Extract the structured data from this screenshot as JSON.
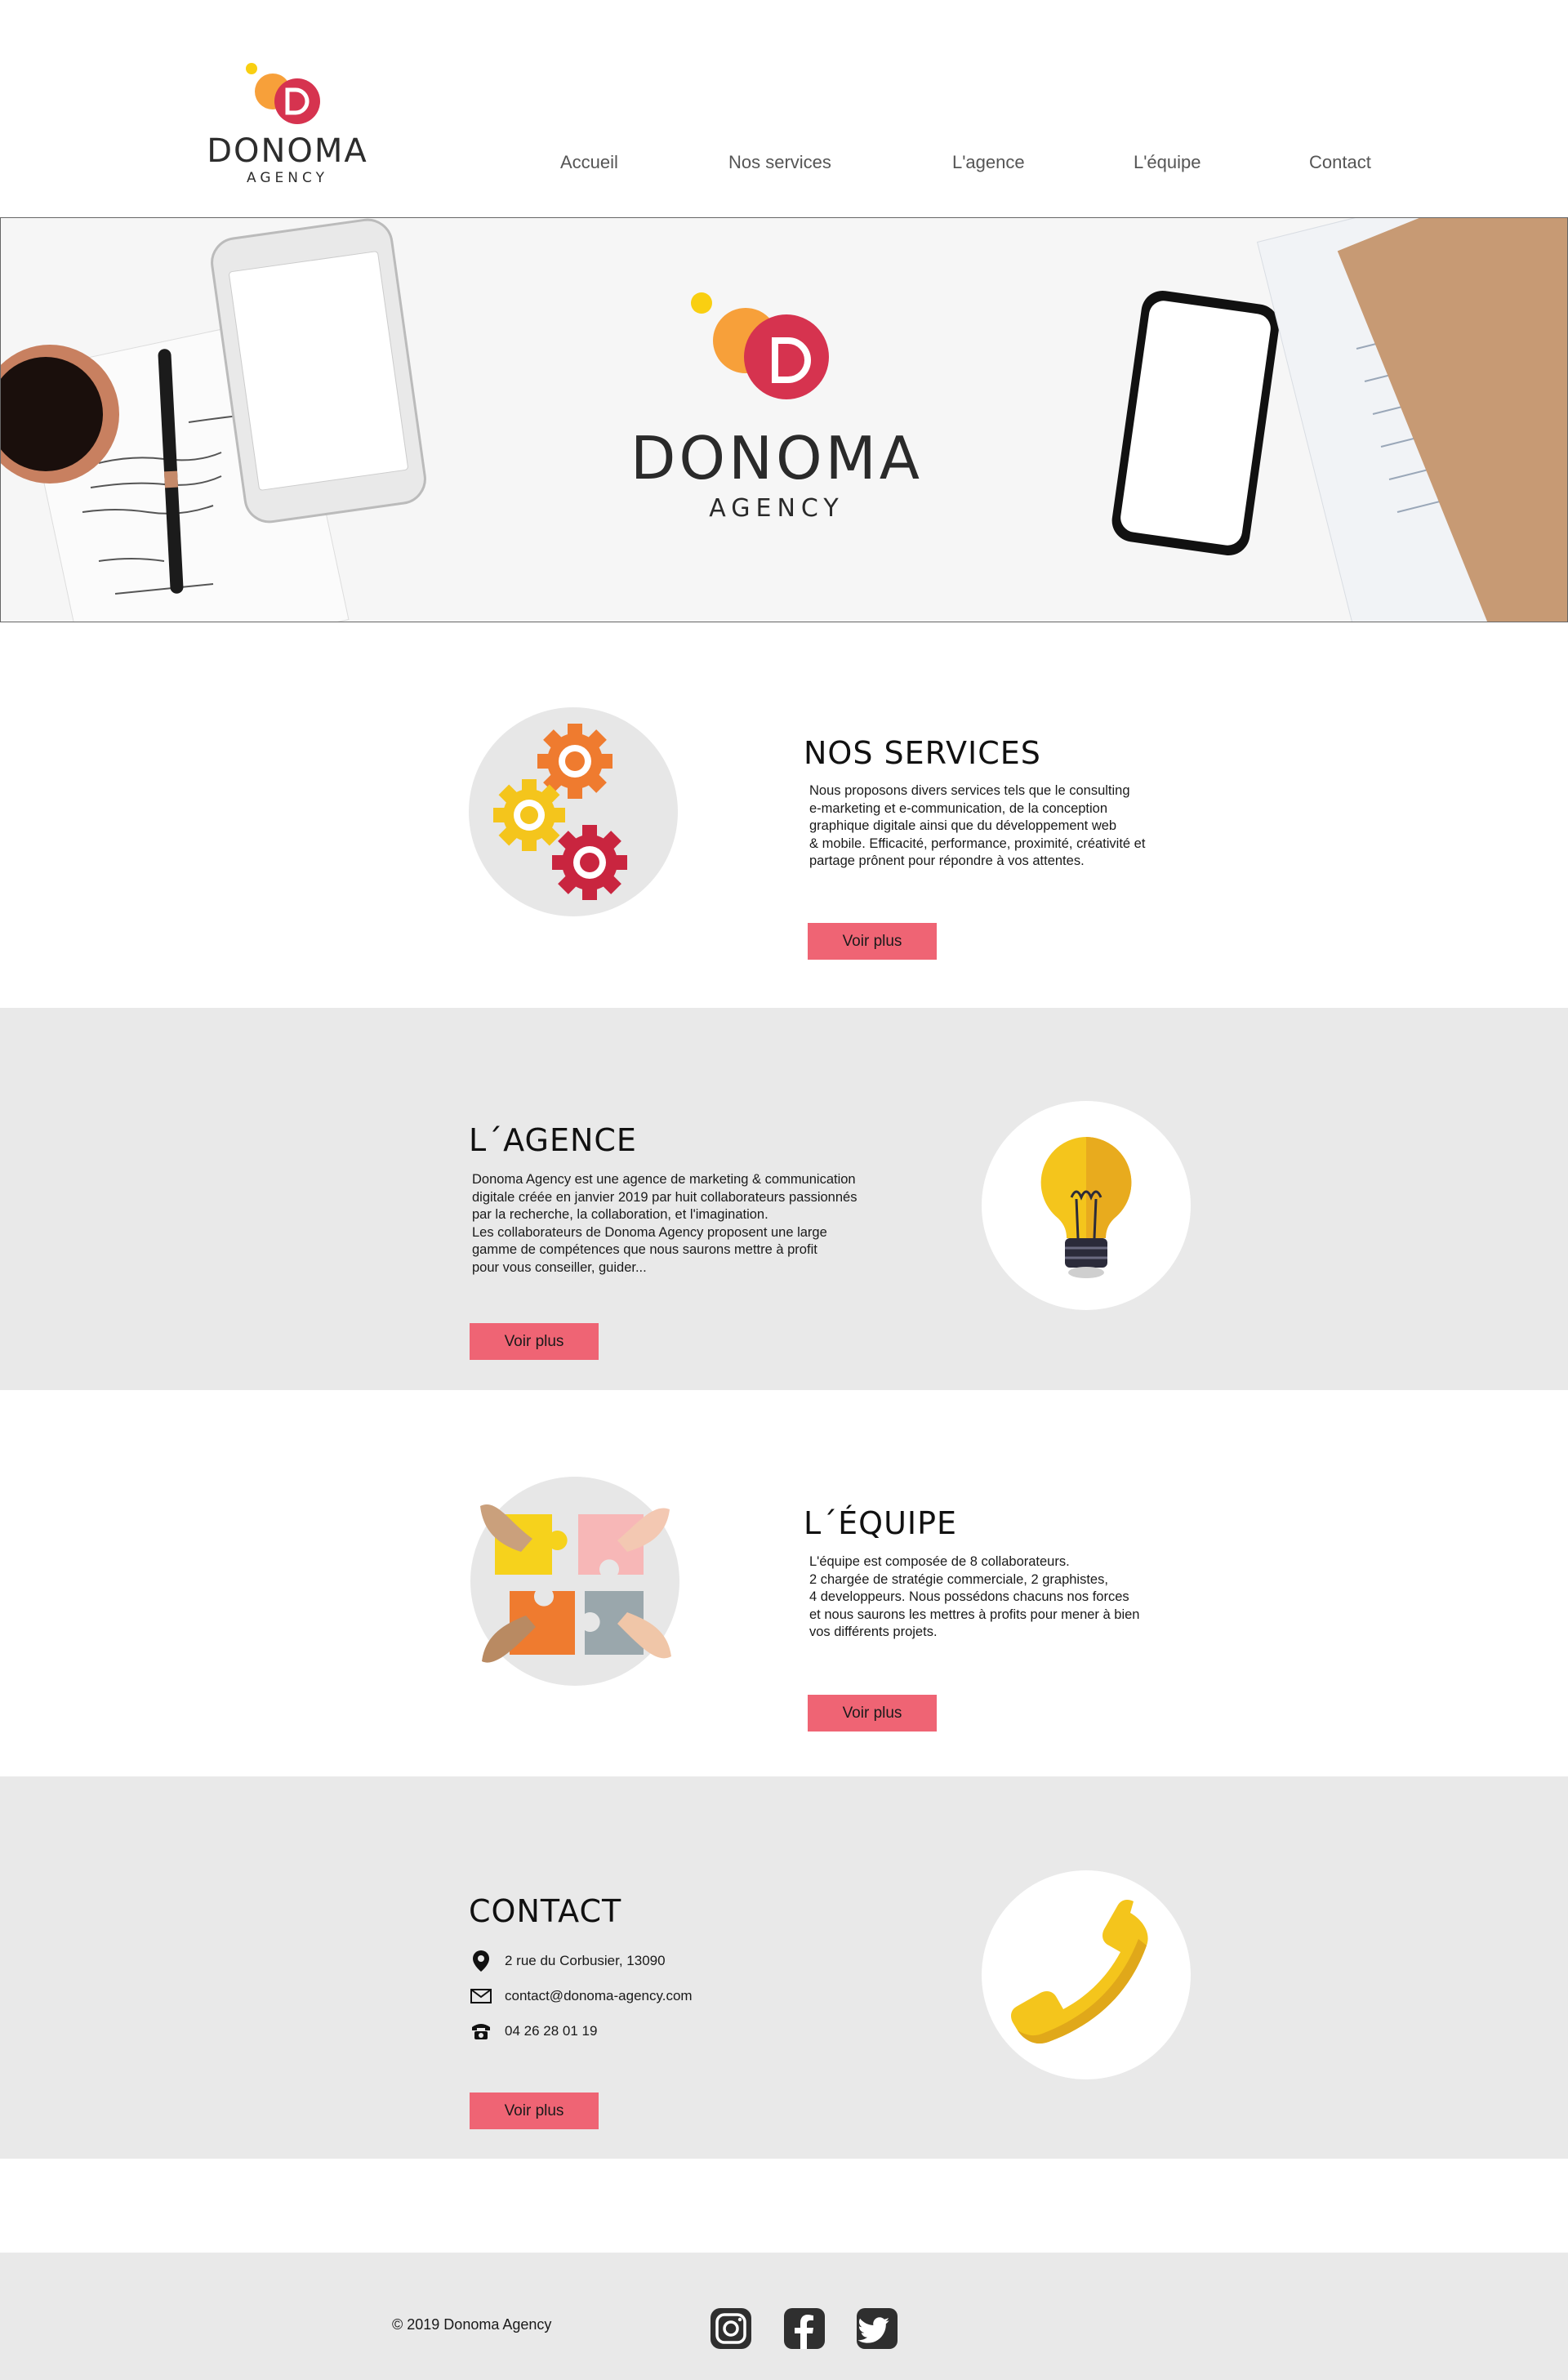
{
  "brand": {
    "name": "DONOMA",
    "sub": "AGENCY"
  },
  "nav": [
    "Accueil",
    "Nos services",
    "L'agence",
    "L'équipe",
    "Contact"
  ],
  "colors": {
    "accent": "#ef6474",
    "band": "#e9e9e9",
    "logo_red": "#d6334f",
    "logo_orange": "#f7a03a",
    "logo_yellow": "#f9cf11"
  },
  "services": {
    "title": "NOS SERVICES",
    "text": "Nous proposons divers services tels que le consulting\ne-marketing et e-communication, de la conception\ngraphique digitale ainsi que du développement web\n& mobile. Efficacité, performance, proximité, créativité et\npartage prônent pour répondre à vos attentes.",
    "button": "Voir plus",
    "icon": "gears-icon"
  },
  "agence": {
    "title": "L´AGENCE",
    "text": "Donoma Agency est une agence de marketing & communication\ndigitale créée en janvier 2019 par huit collaborateurs passionnés\npar la recherche, la collaboration, et l'imagination.\nLes collaborateurs de Donoma Agency proposent une large\ngamme de compétences que nous saurons mettre à profit\npour vous conseiller, guider...",
    "button": "Voir plus",
    "icon": "lightbulb-icon"
  },
  "equipe": {
    "title": "L´ÉQUIPE",
    "text": "L'équipe est composée de 8 collaborateurs.\n2 chargée de stratégie commerciale, 2 graphistes,\n4 developpeurs. Nous possédons chacuns nos forces\net nous saurons les mettres à profits pour mener à bien\nvos différents projets.",
    "button": "Voir plus",
    "icon": "puzzle-hands-icon"
  },
  "contact": {
    "title": "CONTACT",
    "address": "2 rue du Corbusier, 13090",
    "email": "contact@donoma-agency.com",
    "phone": "04 26 28 01 19",
    "button": "Voir plus",
    "icon": "phone-icon"
  },
  "footer": {
    "copyright": "© 2019 Donoma Agency",
    "social": [
      "instagram-icon",
      "facebook-icon",
      "twitter-icon"
    ]
  }
}
